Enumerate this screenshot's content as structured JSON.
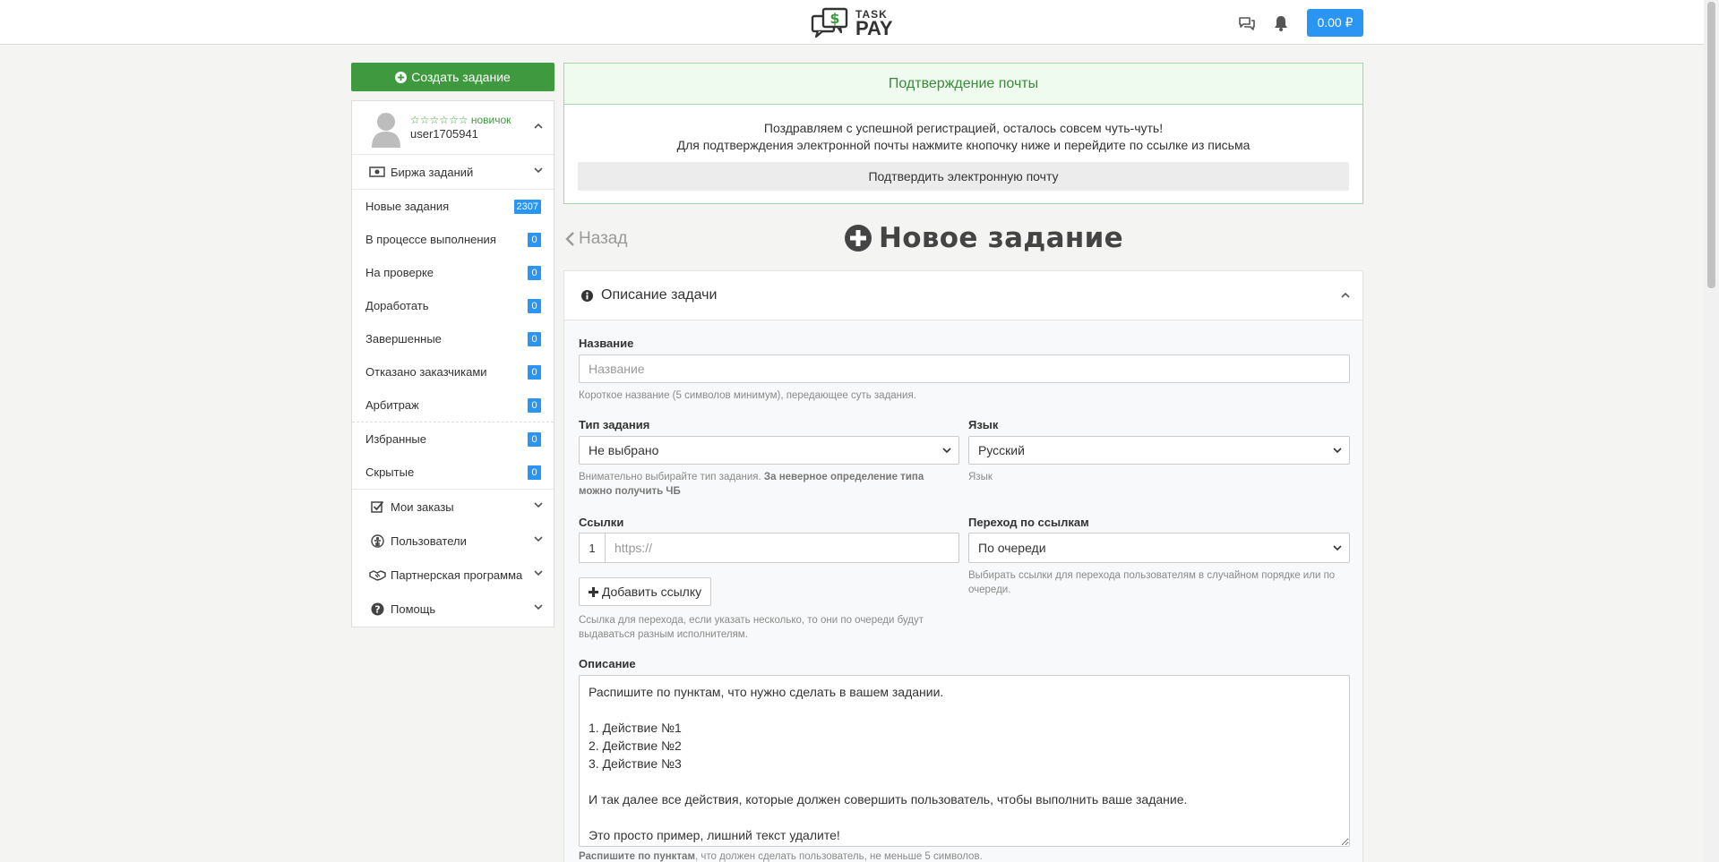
{
  "header": {
    "logo_line1": "TASK",
    "logo_line2": "PAY",
    "logo_symbol": "$",
    "balance": "0.00 ₽",
    "icons": [
      "chat-icon",
      "bell-icon"
    ]
  },
  "sidebar": {
    "create_button": "Создать задание",
    "profile": {
      "rating": "☆☆☆☆☆☆ новичок",
      "username": "user1705941"
    },
    "exchange_label": "Биржа заданий",
    "exchange_items": [
      {
        "label": "Новые задания",
        "count": "2307"
      },
      {
        "label": "В процессе выполнения",
        "count": "0"
      },
      {
        "label": "На проверке",
        "count": "0"
      },
      {
        "label": "Доработать",
        "count": "0"
      },
      {
        "label": "Завершенные",
        "count": "0"
      },
      {
        "label": "Отказано заказчиками",
        "count": "0"
      },
      {
        "label": "Арбитраж",
        "count": "0"
      }
    ],
    "extra_items": [
      {
        "label": "Избранные",
        "count": "0"
      },
      {
        "label": "Скрытые",
        "count": "0"
      }
    ],
    "sections": [
      {
        "label": "Мои заказы",
        "icon": "checkbox-icon"
      },
      {
        "label": "Пользователи",
        "icon": "users-icon"
      },
      {
        "label": "Партнерская программа",
        "icon": "handshake-icon"
      },
      {
        "label": "Помощь",
        "icon": "question-icon"
      }
    ]
  },
  "alert": {
    "title": "Подтверждение почты",
    "line1": "Поздравляем с успешной регистрацией, осталось совсем чуть-чуть!",
    "line2": "Для подтверждения электронной почты нажмите кнопочку ниже и перейдите по ссылке из письма",
    "button": "Подтвердить электронную почту"
  },
  "page": {
    "back": "Назад",
    "title": "Новое задание"
  },
  "form": {
    "panel_title": "Описание задачи",
    "name_label": "Название",
    "name_placeholder": "Название",
    "name_help": "Короткое название (5 символов минимум), передающее суть задания.",
    "type_label": "Тип задания",
    "type_value": "Не выбрано",
    "type_help_plain": "Внимательно выбирайте тип задания. ",
    "type_help_bold": "За неверное определение типа можно получить ЧБ",
    "lang_label": "Язык",
    "lang_value": "Русский",
    "lang_help": "Язык",
    "links_label": "Ссылки",
    "links_index": "1",
    "links_placeholder": "https://",
    "add_link_button": "Добавить ссылку",
    "links_help": "Ссылка для перехода, если указать несколько, то они по очереди будут выдаваться разным исполнителям.",
    "transition_label": "Переход по ссылкам",
    "transition_value": "По очереди",
    "transition_help": "Выбирать ссылки для перехода пользователям в случайном порядке или по очереди.",
    "desc_label": "Описание",
    "desc_value": "Распишите по пунктам, что нужно сделать в вашем задании.\n\n1. Действие №1\n2. Действие №2\n3. Действие №3\n\nИ так далее все действия, которые должен совершить пользователь, чтобы выполнить ваше задание.\n\nЭто просто пример, лишний текст удалите!",
    "desc_help_bold": "Распишите по пунктам",
    "desc_help_plain": ", что должен сделать пользователь, не меньше 5 символов."
  },
  "colors": {
    "accent_blue": "#2a95f3",
    "create_green": "#3f9a3f",
    "alert_green": "#3a8a3a"
  }
}
